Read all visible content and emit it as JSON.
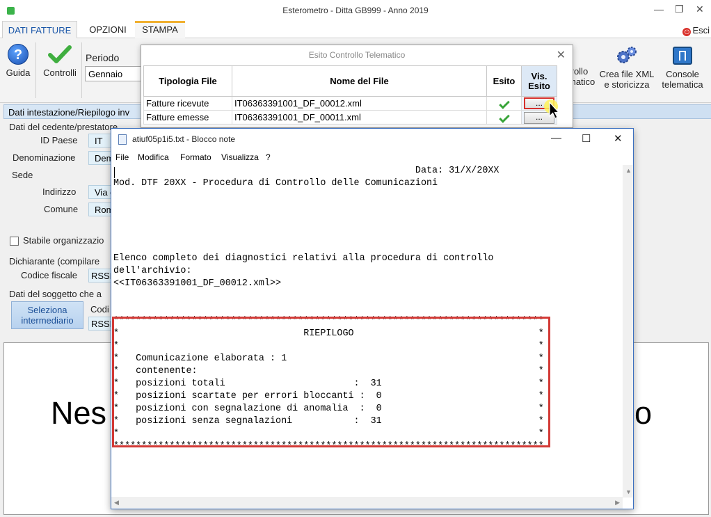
{
  "window": {
    "title": "Esterometro - Ditta GB999 - Anno 2019"
  },
  "ribbon_tabs": [
    "DATI FATTURE",
    "OPZIONI",
    "STAMPA"
  ],
  "exit_label": "Esci",
  "ribbon": {
    "help_label": "Guida",
    "controlli_label": "Controlli",
    "periodo_label": "Periodo",
    "periodo_value": "Gennaio",
    "controllo_label_1": "trollo",
    "controllo_label_2": "matico",
    "crea_label_1": "Crea file XML",
    "crea_label_2": "e storicizza",
    "console_label_1": "Console",
    "console_label_2": "telematica"
  },
  "form": {
    "section_tab": "Dati intestazione/Riepilogo inv",
    "cedente_group": "Dati del cedente/prestatore",
    "id_paese_label": "ID Paese",
    "id_paese_value": "IT",
    "denominazione_label": "Denominazione",
    "denominazione_value": "Dem",
    "sede_label": "Sede",
    "indirizzo_label": "Indirizzo",
    "indirizzo_value": "Via d",
    "comune_label": "Comune",
    "comune_value": "Rom",
    "stabile_label": "Stabile organizzazio",
    "dichiarante_group": "Dichiarante (compilare",
    "codice_fiscale_label": "Codice fiscale",
    "codice_fiscale_value": "RSSN",
    "soggetto_group": "Dati del soggetto che a",
    "seleziona_label_1": "Seleziona",
    "seleziona_label_2": "intermediario",
    "codi_label": "Codi",
    "codi_value": "RSSN",
    "big_left": "Nes",
    "big_right": "lo"
  },
  "esito_dialog": {
    "title": "Esito Controllo Telematico",
    "headers": {
      "tipologia": "Tipologia File",
      "nome": "Nome del File",
      "esito": "Esito",
      "vis1": "Vis.",
      "vis2": "Esito"
    },
    "rows": [
      {
        "tipologia": "Fatture ricevute",
        "nome": "IT06363391001_DF_00012.xml",
        "button": "..."
      },
      {
        "tipologia": "Fatture emesse",
        "nome": "IT06363391001_DF_00011.xml",
        "button": "..."
      }
    ]
  },
  "notepad": {
    "title": "atiuf05p1i5.txt - Blocco note",
    "menu": [
      "File",
      "Modifica",
      "Formato",
      "Visualizza",
      "?"
    ],
    "content": "                                                      Data: 31/X/20XX\nMod. DTF 20XX - Procedura di Controllo delle Comunicazioni\n\n\n\n\n\nElenco completo dei diagnostici relativi alla procedura di controllo\ndell'archivio:\n<<IT06363391001_DF_00012.xml>>\n\n\n*****************************************************************************\n*                                 RIEPILOGO                                 *\n*                                                                           *\n*   Comunicazione elaborata : 1                                             *\n*   contenente:                                                             *\n*   posizioni totali                       :  31                            *\n*   posizioni scartate per errori bloccanti :  0                            *\n*   posizioni con segnalazione di anomalia  :  0                            *\n*   posizioni senza segnalazioni           :  31                            *\n*                                                                           *\n*****************************************************************************"
  },
  "colors": {
    "accent": "#1a56a8",
    "highlight_red": "#d33a36",
    "check_green": "#3aa53a"
  }
}
